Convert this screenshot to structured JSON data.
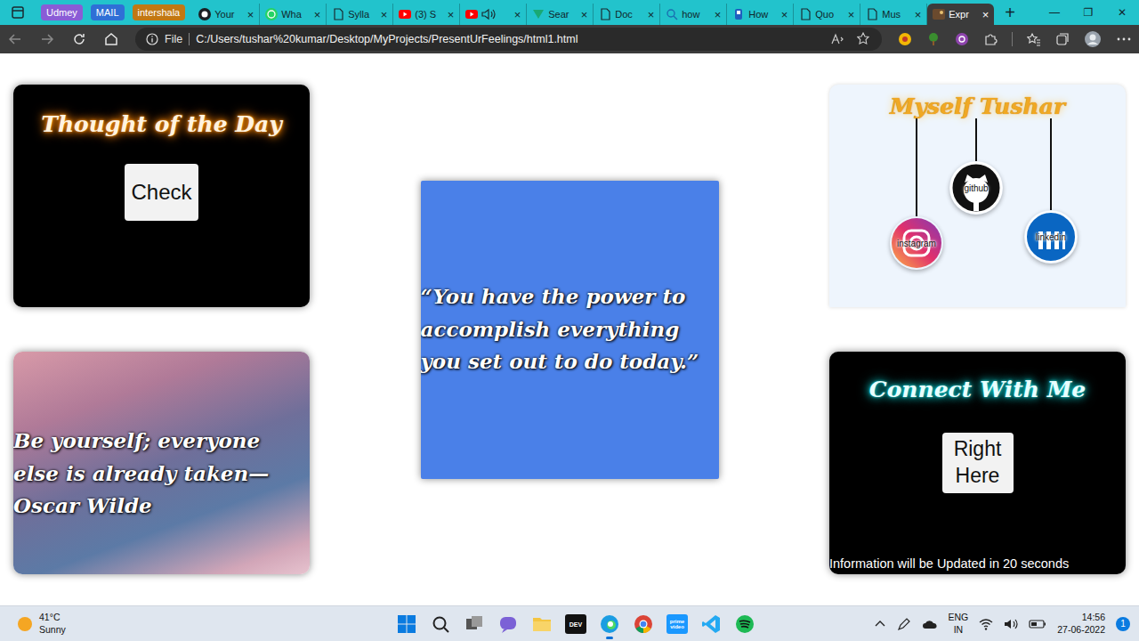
{
  "browser": {
    "tab_groups": [
      {
        "label": "Udmey",
        "color": "#8a5cd6"
      },
      {
        "label": "MAIL",
        "color": "#2f6fd6"
      },
      {
        "label": "intershala",
        "color": "#c27812"
      }
    ],
    "tabs": [
      {
        "label": "Your",
        "kind": "github",
        "audio": false,
        "selected": false
      },
      {
        "label": "Wha",
        "kind": "whatsapp",
        "audio": false,
        "selected": false
      },
      {
        "label": "Sylla",
        "kind": "doc",
        "audio": false,
        "selected": false
      },
      {
        "label": "(3) S",
        "kind": "youtube",
        "audio": false,
        "selected": false
      },
      {
        "label": "",
        "kind": "youtube",
        "audio": true,
        "selected": false
      },
      {
        "label": "Sear",
        "kind": "vine",
        "audio": false,
        "selected": false
      },
      {
        "label": "Doc",
        "kind": "doc",
        "audio": false,
        "selected": false
      },
      {
        "label": "how",
        "kind": "search",
        "audio": false,
        "selected": false
      },
      {
        "label": "How",
        "kind": "perplexity",
        "audio": false,
        "selected": false
      },
      {
        "label": "Quo",
        "kind": "doc",
        "audio": false,
        "selected": false
      },
      {
        "label": "Mus",
        "kind": "doc",
        "audio": false,
        "selected": false
      },
      {
        "label": "Expr",
        "kind": "photo",
        "audio": false,
        "selected": true
      }
    ],
    "tab_close": "×",
    "new_tab": "+",
    "window_controls": [
      "—",
      "❐",
      "✕"
    ],
    "address": {
      "scheme": "File",
      "url": "C:/Users/tushar%20kumar/Desktop/MyProjects/PresentUrFeelings/html1.html"
    }
  },
  "page": {
    "thought_card": {
      "title": "Thought of the Day",
      "button": "Check"
    },
    "quote_card": {
      "text": "Be yourself; everyone else is already taken— Oscar Wilde"
    },
    "center_card": {
      "text": "“You have the power to accomplish everything you set out to do today.”"
    },
    "profile_card": {
      "title": "Myself Tushar",
      "links": [
        {
          "label": "instagram",
          "kind": "instagram"
        },
        {
          "label": "github",
          "kind": "github"
        },
        {
          "label": "linkedin",
          "kind": "linkedin"
        }
      ]
    },
    "connect_card": {
      "title": "Connect With Me",
      "button": "Right Here",
      "footer": "Information will be Updated in 20 seconds"
    }
  },
  "taskbar": {
    "weather": {
      "temp": "41°C",
      "condition": "Sunny"
    },
    "apps": [
      {
        "kind": "start",
        "text": "",
        "selected": false
      },
      {
        "kind": "search",
        "text": "",
        "selected": false
      },
      {
        "kind": "taskview",
        "text": "",
        "selected": false
      },
      {
        "kind": "chat",
        "text": "",
        "selected": false
      },
      {
        "kind": "explorer",
        "text": "",
        "selected": false
      },
      {
        "kind": "dev",
        "text": "DEV",
        "selected": false
      },
      {
        "kind": "edge",
        "text": "",
        "selected": true
      },
      {
        "kind": "chrome",
        "text": "",
        "selected": false
      },
      {
        "kind": "prime",
        "text": "prime video",
        "selected": false
      },
      {
        "kind": "vscode",
        "text": "",
        "selected": false
      },
      {
        "kind": "spotify",
        "text": "",
        "selected": false
      }
    ],
    "language": {
      "lang": "ENG",
      "region": "IN"
    },
    "clock": {
      "time": "14:56",
      "date": "27-06-2022"
    },
    "notifications": "1"
  }
}
